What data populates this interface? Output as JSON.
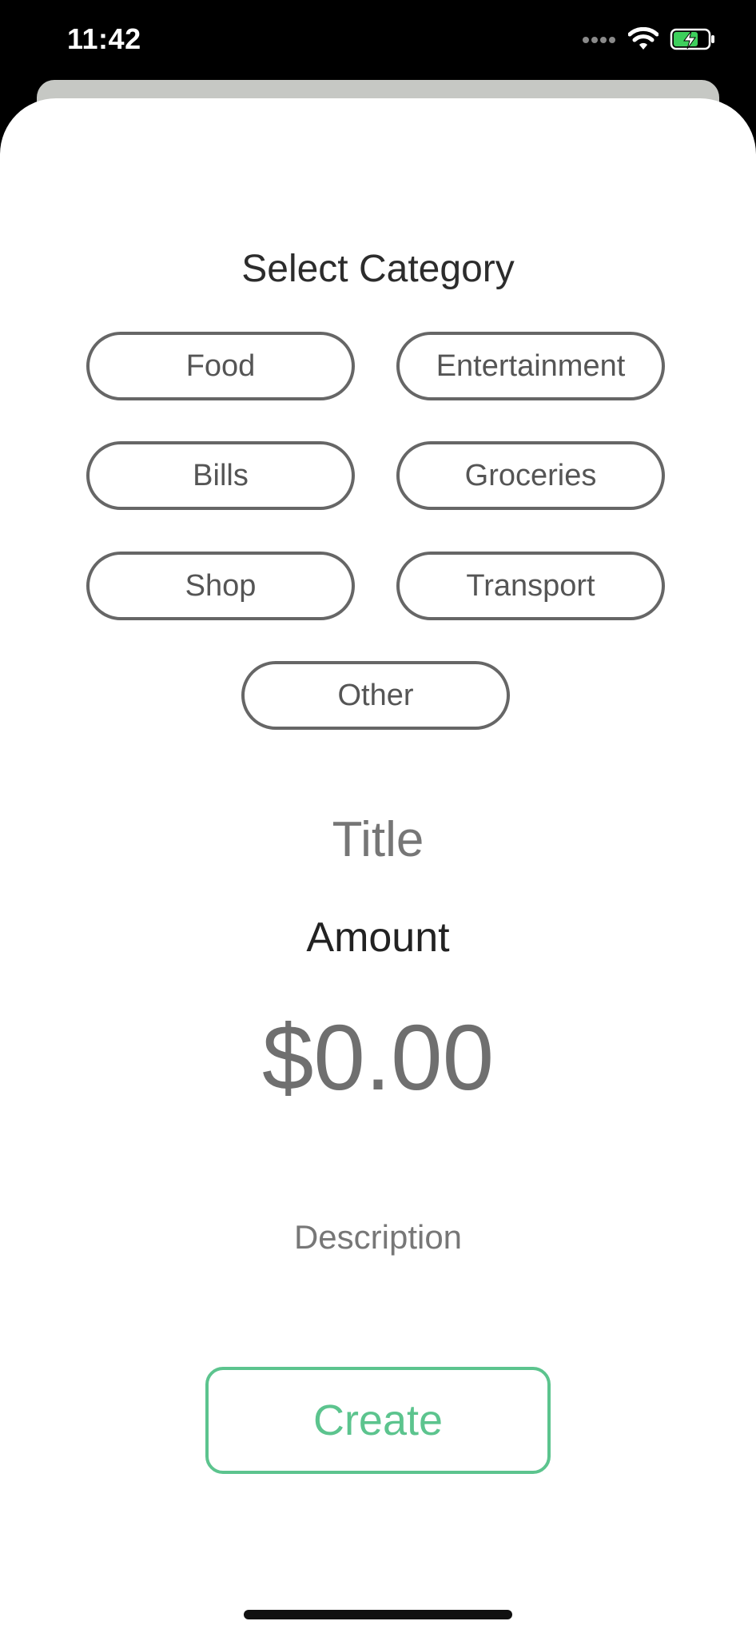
{
  "status_bar": {
    "time": "11:42",
    "signal_icon": "cellular-dots-icon",
    "wifi_icon": "wifi-icon",
    "battery_icon": "battery-charging-icon",
    "battery_color": "#3ecf5c"
  },
  "category": {
    "heading": "Select Category",
    "options": [
      "Food",
      "Entertainment",
      "Bills",
      "Groceries",
      "Shop",
      "Transport",
      "Other"
    ]
  },
  "form": {
    "title_placeholder": "Title",
    "amount_label": "Amount",
    "amount_value": "$0.00",
    "description_placeholder": "Description",
    "create_label": "Create"
  },
  "colors": {
    "accent": "#5cc48e",
    "pill_border": "#666666"
  }
}
